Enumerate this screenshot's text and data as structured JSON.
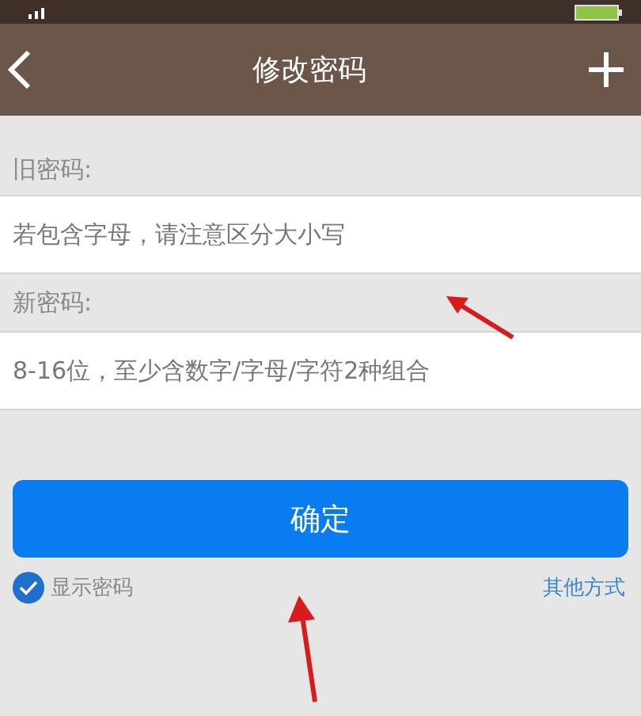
{
  "header": {
    "title": "修改密码"
  },
  "fields": [
    {
      "label": "旧密码:",
      "placeholder": "若包含字母，请注意区分大小写"
    },
    {
      "label": "新密码:",
      "placeholder": "8-16位，至少含数字/字母/字符2种组合"
    }
  ],
  "confirm_button": "确定",
  "show_password": {
    "label": "显示密码",
    "checked": true
  },
  "other_link": "其他方式"
}
